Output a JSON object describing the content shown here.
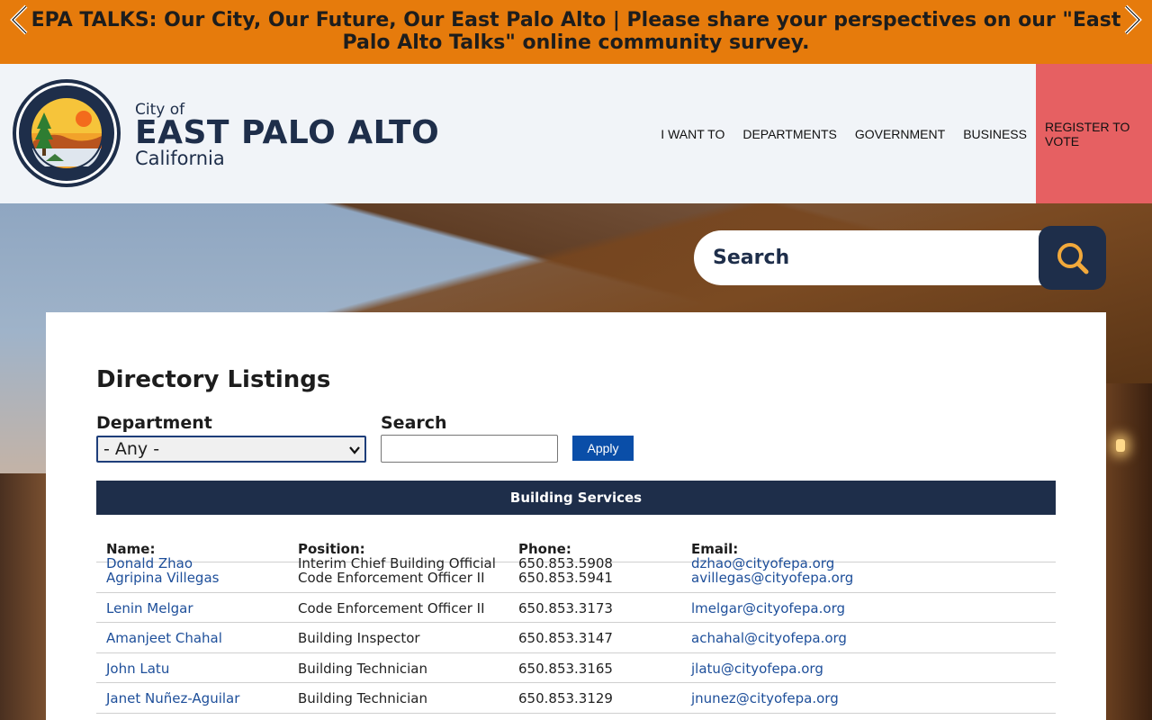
{
  "alert": {
    "text": "EPA TALKS: Our City, Our Future, Our East Palo Alto | Please share your perspectives on our \"East Palo Alto Talks\" online community survey."
  },
  "logo": {
    "city_of": "City of",
    "name": "EAST PALO ALTO",
    "state": "California"
  },
  "nav": {
    "items": [
      "I WANT TO",
      "DEPARTMENTS",
      "GOVERNMENT",
      "BUSINESS",
      "REGISTER TO VOTE"
    ]
  },
  "site_search": {
    "placeholder": "Search"
  },
  "directory": {
    "title": "Directory Listings",
    "department_label": "Department",
    "department_value": "- Any -",
    "search_label": "Search",
    "search_value": "",
    "apply_label": "Apply",
    "section": "Building Services",
    "columns": [
      "Name:",
      "Position:",
      "Phone:",
      "Email:"
    ],
    "rows": [
      {
        "name": "Donald Zhao",
        "position": "Interim Chief Building Official",
        "phone": "650.853.5908",
        "email": "dzhao@cityofepa.org"
      },
      {
        "name": "Agripina Villegas",
        "position": "Code Enforcement Officer II",
        "phone": "650.853.5941",
        "email": "avillegas@cityofepa.org"
      },
      {
        "name": "Lenin Melgar",
        "position": "Code Enforcement Officer II",
        "phone": "650.853.3173",
        "email": "lmelgar@cityofepa.org"
      },
      {
        "name": "Amanjeet Chahal",
        "position": "Building Inspector",
        "phone": "650.853.3147",
        "email": "achahal@cityofepa.org"
      },
      {
        "name": "John Latu",
        "position": "Building Technician",
        "phone": "650.853.3165",
        "email": "jlatu@cityofepa.org"
      },
      {
        "name": "Janet Nuñez-Aguilar",
        "position": "Building Technician",
        "phone": "650.853.3129",
        "email": "jnunez@cityofepa.org"
      }
    ]
  },
  "colors": {
    "alert_bg": "#e67b0c",
    "navy": "#1e2e4a",
    "vote_bg": "#e66062",
    "link": "#1e4f9a",
    "apply_bg": "#0a4ea8"
  }
}
